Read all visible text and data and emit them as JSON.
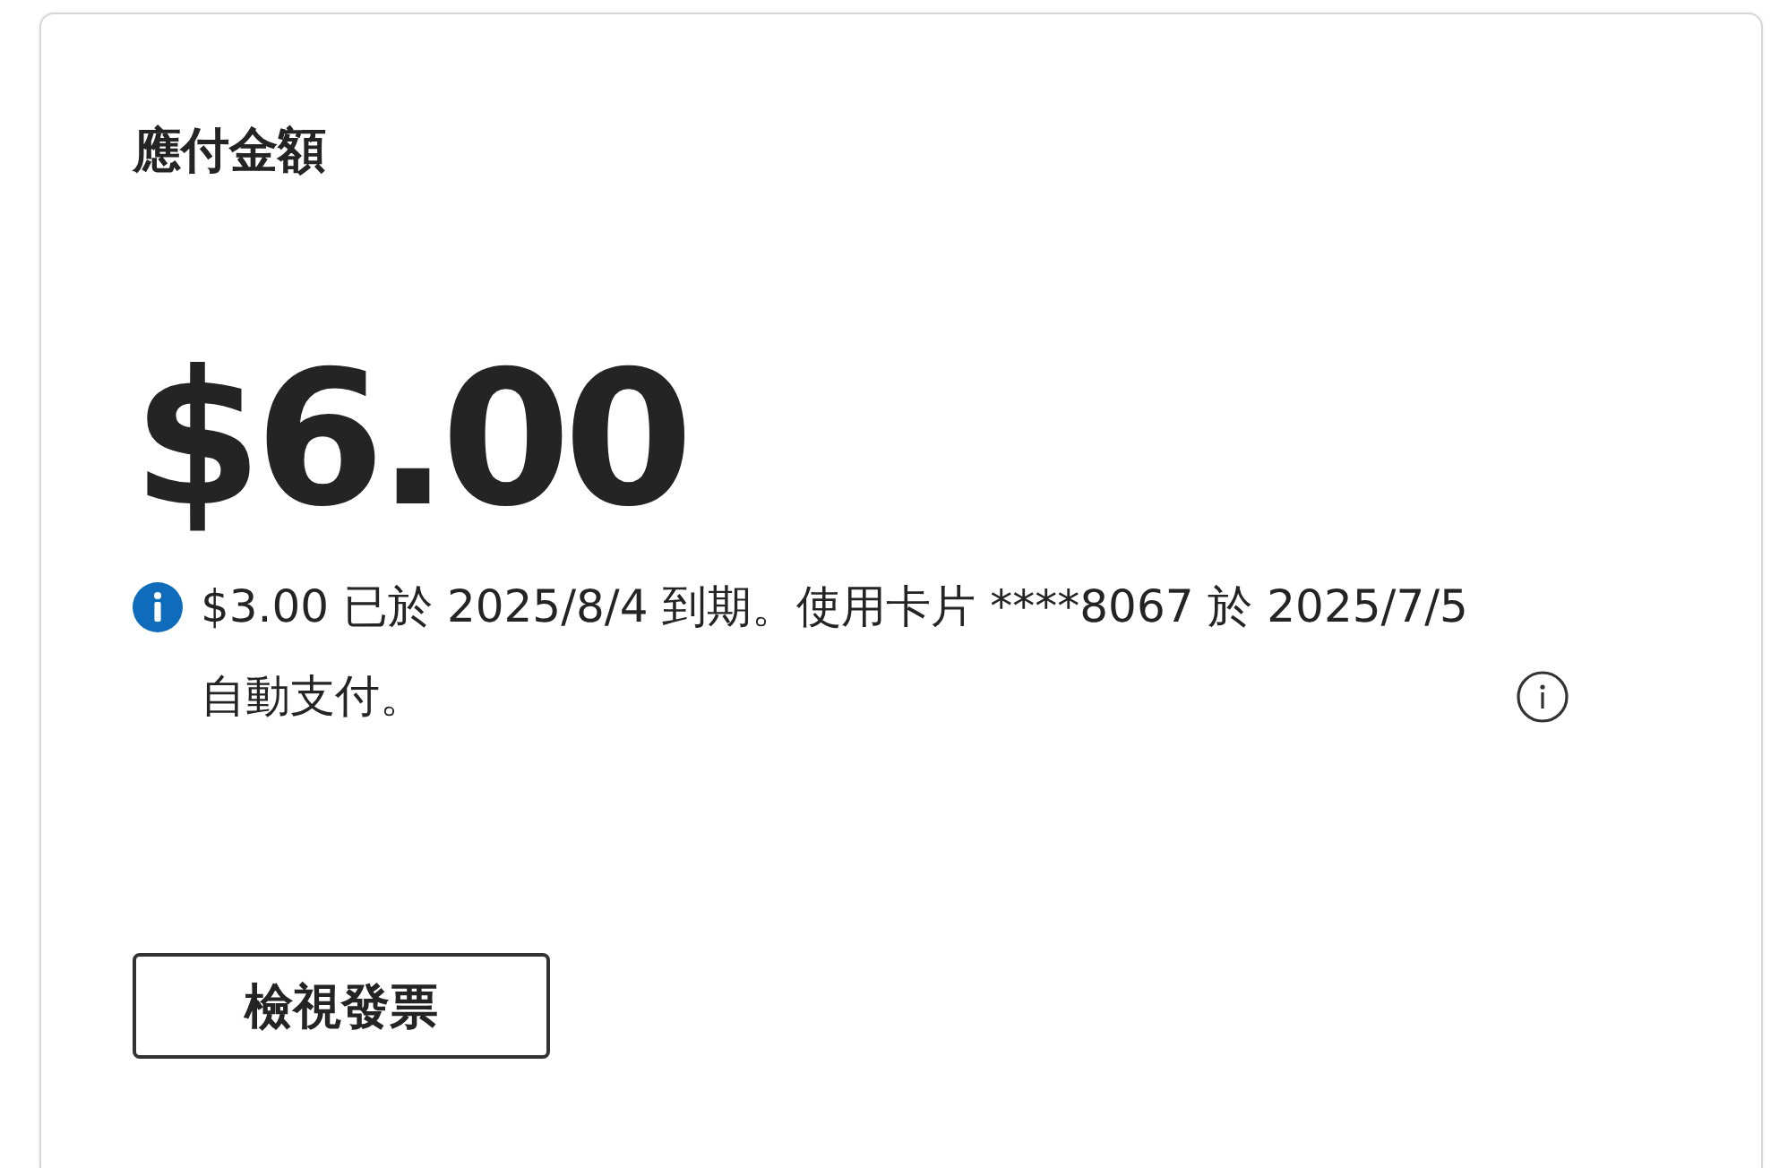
{
  "card": {
    "title": "應付金額",
    "amount": "$6.00",
    "notice": "$3.00 已於 2025/8/4 到期。使用卡片 ****8067 於 2025/7/5 自動支付。",
    "button": "檢視發票"
  }
}
